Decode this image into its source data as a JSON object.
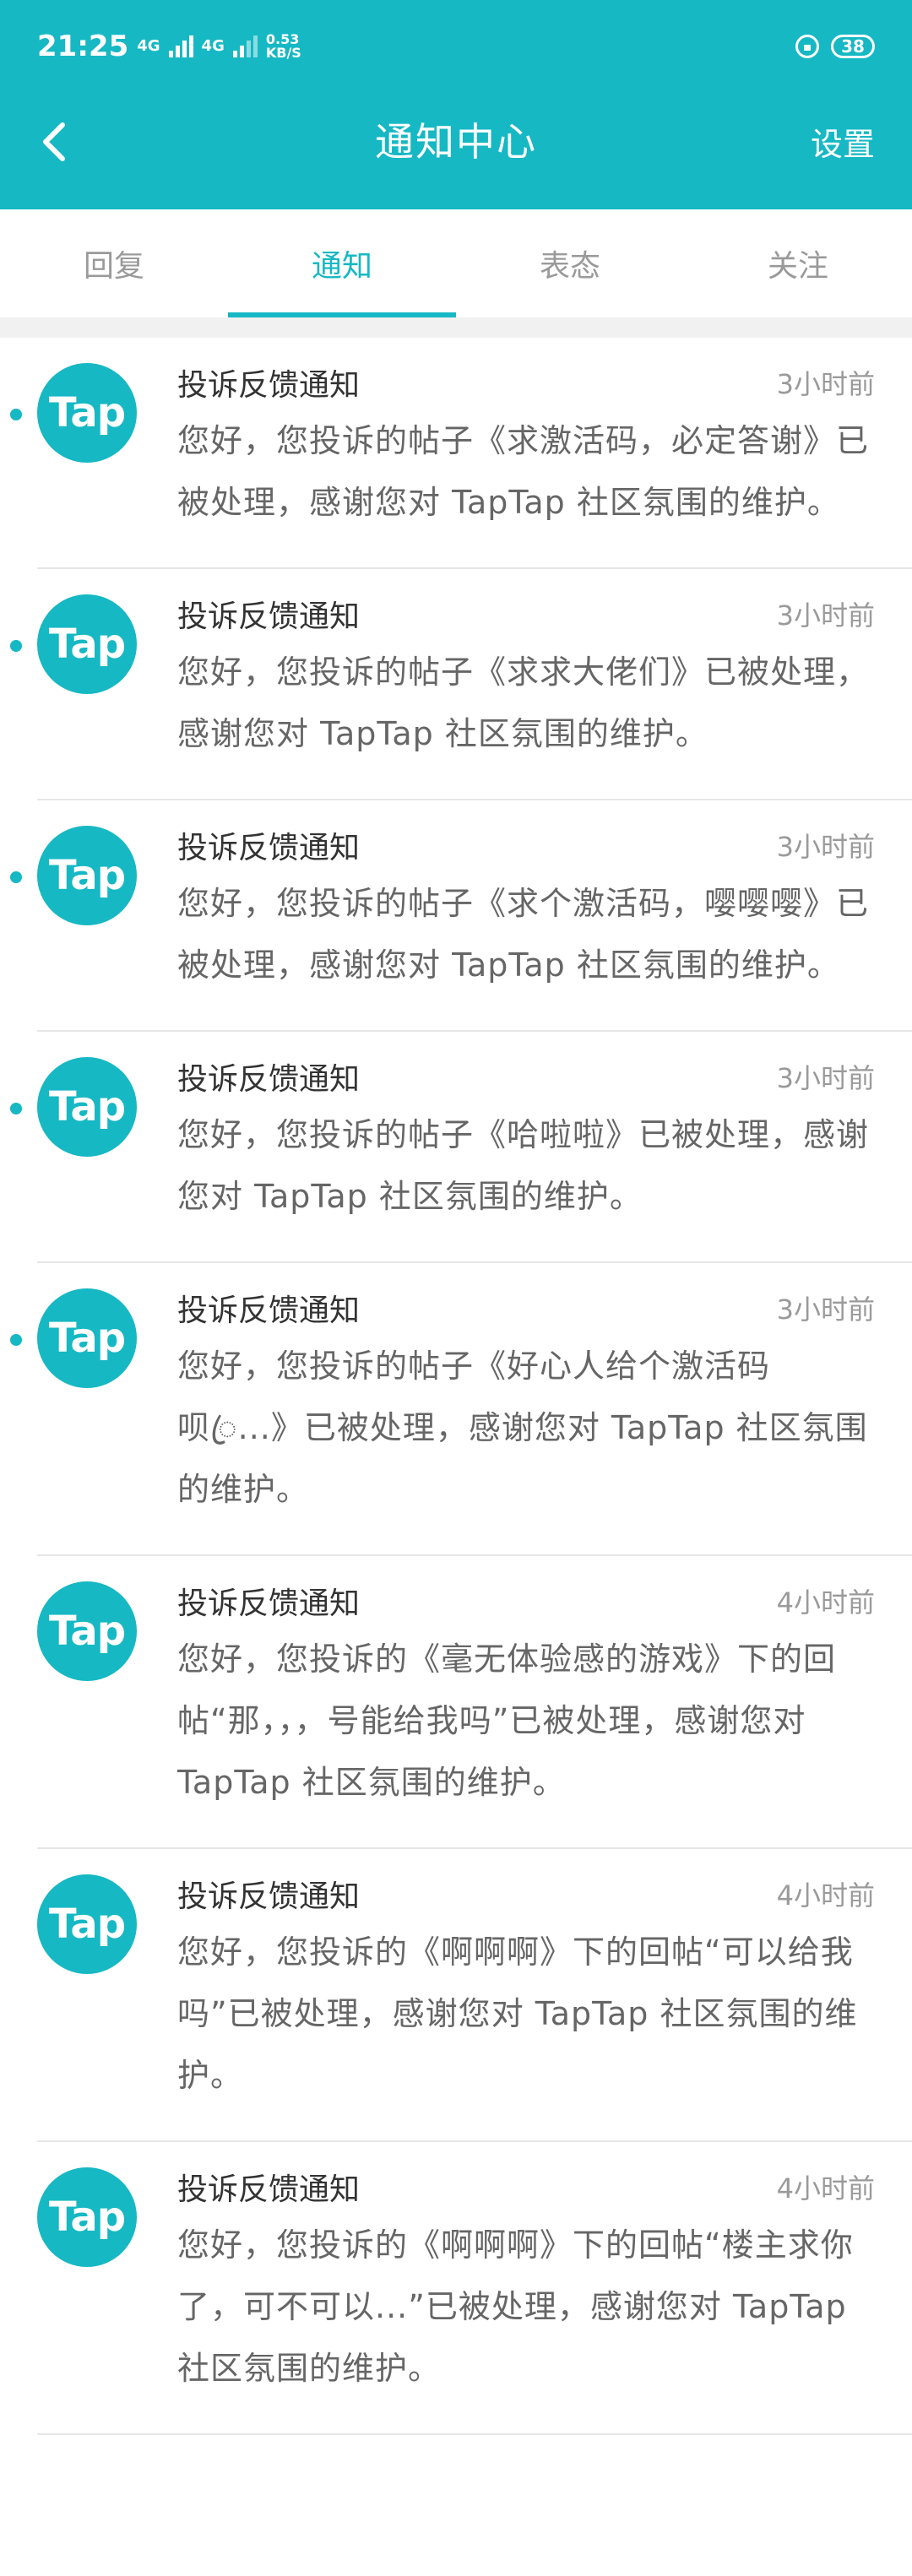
{
  "status_bar": {
    "time": "21:25",
    "net_a": "4G",
    "net_b": "4G",
    "speed_value": "0.53",
    "speed_unit": "KB/S",
    "battery": "38"
  },
  "nav": {
    "title": "通知中心",
    "settings_label": "设置"
  },
  "tabs": [
    {
      "label": "回复",
      "active": false
    },
    {
      "label": "通知",
      "active": true
    },
    {
      "label": "表态",
      "active": false
    },
    {
      "label": "关注",
      "active": false
    }
  ],
  "notifications": [
    {
      "avatar": "Tap",
      "title": "投诉反馈通知",
      "time": "3小时前",
      "unread": true,
      "body": "您好，您投诉的帖子《求激活码，必定答谢》已被处理，感谢您对 TapTap 社区氛围的维护。"
    },
    {
      "avatar": "Tap",
      "title": "投诉反馈通知",
      "time": "3小时前",
      "unread": true,
      "body": "您好，您投诉的帖子《求求大佬们》已被处理，感谢您对 TapTap 社区氛围的维护。"
    },
    {
      "avatar": "Tap",
      "title": "投诉反馈通知",
      "time": "3小时前",
      "unread": true,
      "body": "您好，您投诉的帖子《求个激活码，嘤嘤嘤》已被处理，感谢您对 TapTap 社区氛围的维护。"
    },
    {
      "avatar": "Tap",
      "title": "投诉反馈通知",
      "time": "3小时前",
      "unread": true,
      "body": "您好，您投诉的帖子《哈啦啦》已被处理，感谢您对 TapTap 社区氛围的维护。"
    },
    {
      "avatar": "Tap",
      "title": "投诉反馈通知",
      "time": "3小时前",
      "unread": true,
      "body": "您好，您投诉的帖子《好心人给个激活码呗ꦿ...》已被处理，感谢您对 TapTap 社区氛围的维护。"
    },
    {
      "avatar": "Tap",
      "title": "投诉反馈通知",
      "time": "4小时前",
      "unread": false,
      "body": "您好，您投诉的《毫无体验感的游戏》下的回帖“那，，，号能给我吗”已被处理，感谢您对 TapTap 社区氛围的维护。"
    },
    {
      "avatar": "Tap",
      "title": "投诉反馈通知",
      "time": "4小时前",
      "unread": false,
      "body": "您好，您投诉的《啊啊啊》下的回帖“可以给我吗”已被处理，感谢您对 TapTap 社区氛围的维护。"
    },
    {
      "avatar": "Tap",
      "title": "投诉反馈通知",
      "time": "4小时前",
      "unread": false,
      "body": "您好，您投诉的《啊啊啊》下的回帖“楼主求你了，可不可以...”已被处理，感谢您对 TapTap 社区氛围的维护。"
    }
  ]
}
